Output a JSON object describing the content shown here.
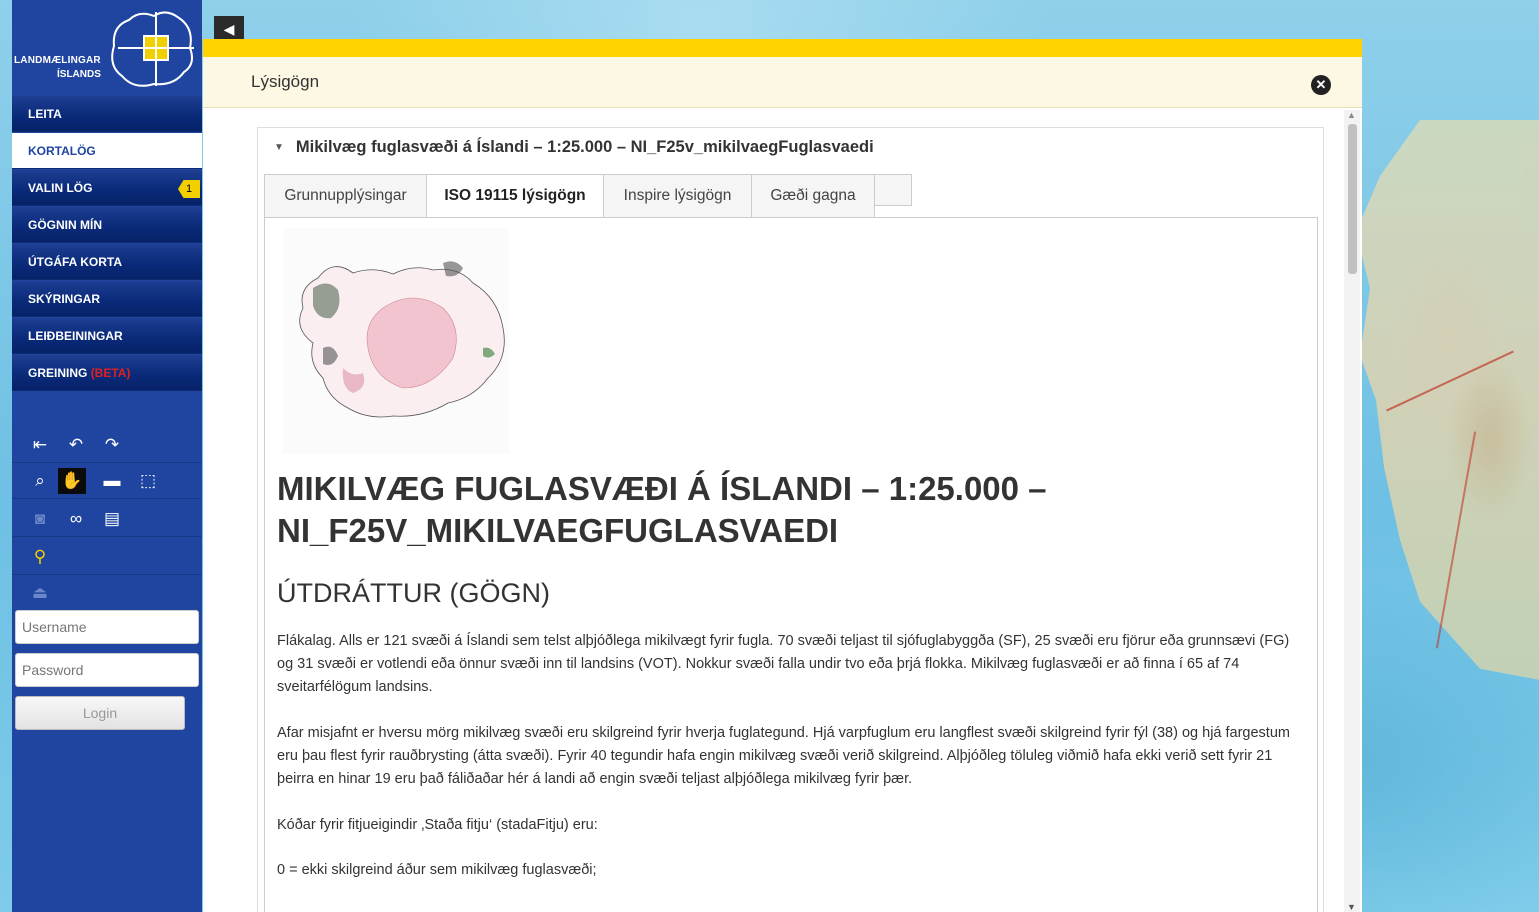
{
  "sidebar": {
    "logo": {
      "line1": "LANDMÆLINGAR",
      "line2": "ÍSLANDS"
    },
    "nav": [
      {
        "label": "LEITA"
      },
      {
        "label": "KORTALÖG"
      },
      {
        "label": "VALIN LÖG",
        "badge": "1"
      },
      {
        "label": "GÖGNIN MÍN"
      },
      {
        "label": "ÚTGÁFA KORTA"
      },
      {
        "label": "SKÝRINGAR"
      },
      {
        "label": "LEIÐBEININGAR"
      },
      {
        "label": "GREINING",
        "suffix": "(BETA)"
      }
    ],
    "active_nav": "KORTALÖG",
    "tools": {
      "row1": [
        "zoom-extent-icon",
        "undo-icon",
        "redo-icon"
      ],
      "row2": [
        "zoom-box-icon",
        "pan-hand-icon",
        "measure-icon",
        "select-box-icon"
      ],
      "row3": [
        "camera-icon",
        "link-icon",
        "print-icon"
      ],
      "row4": [
        "location-arrow-icon"
      ],
      "row5": [
        "upload-icon"
      ]
    },
    "login": {
      "username_placeholder": "Username",
      "password_placeholder": "Password",
      "button": "Login"
    }
  },
  "dialog": {
    "title": "Lýsigögn",
    "heading": "Mikilvæg fuglasvæði á Íslandi – 1:25.000 – NI_F25v_mikilvaegFuglasvaedi",
    "tabs": [
      "Grunnupplýsingar",
      "ISO 19115 lýsigögn",
      "Inspire lýsigögn",
      "Gæði gagna"
    ],
    "active_tab": "ISO 19115 lýsigögn",
    "content": {
      "title": "MIKILVÆG FUGLASVÆÐI Á ÍSLANDI – 1:25.000 – NI_F25V_MIKILVAEGFUGLASVAEDI",
      "section": "ÚTDRÁTTUR (GÖGN)",
      "paragraphs": [
        "Flákalag. Alls er 121 svæði á Íslandi sem telst alþjóðlega mikilvægt fyrir fugla. 70 svæði teljast til sjófuglabyggða (SF), 25 svæði eru fjörur eða grunnsævi (FG) og 31 svæði er votlendi eða önnur svæði inn til landsins (VOT). Nokkur svæði falla undir tvo eða þrjá flokka. Mikilvæg fuglasvæði er að finna í 65 af 74 sveitarfélögum landsins.",
        "Afar misjafnt er hversu mörg mikilvæg svæði eru skilgreind fyrir hverja fuglategund. Hjá varpfuglum eru langflest svæði skilgreind fyrir fýl (38) og hjá fargestum eru þau flest fyrir rauðbrysting (átta svæði). Fyrir 40 tegundir hafa engin mikilvæg svæði verið skilgreind. Alþjóðleg töluleg viðmið hafa ekki verið sett fyrir 21 þeirra en hinar 19 eru það fáliðaðar hér á landi að engin svæði teljast alþjóðlega mikilvæg fyrir þær.",
        "Kóðar fyrir fitjueigindir ‚Staða fitju‘ (stadaFitju) eru:",
        "0 = ekki skilgreind áður sem mikilvæg fuglasvæði;"
      ]
    }
  },
  "colors": {
    "sidebar": "#1f45a0",
    "accent": "#ffd200",
    "badge": "#f2d000",
    "beta": "#e02020"
  }
}
